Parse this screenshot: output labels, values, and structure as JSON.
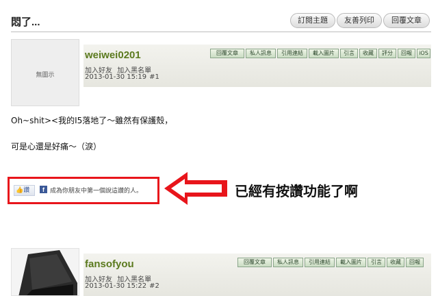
{
  "page": {
    "title": "悶了..."
  },
  "toolbar": {
    "subscribe": "訂閱主題",
    "print": "友善列印",
    "reply": "回覆文章"
  },
  "action_buttons": {
    "reply_post": "回覆文章",
    "private_msg": "私人訊息",
    "quote_link": "引用連結",
    "load_image": "載入圖片",
    "quote": "引言",
    "collect": "收藏",
    "rate": "評分",
    "report": "回報",
    "ios": "iOS"
  },
  "posts": [
    {
      "avatar_text": "無圖示",
      "username": "weiwei0201",
      "add_friend": "加入好友",
      "add_blacklist": "加入黑名單",
      "datetime": "2013-01-30 15:19",
      "number": "#1",
      "body": [
        "Oh~shit><我的I5落地了～雖然有保護殼，",
        "可是心還是好痛～（淚）"
      ]
    },
    {
      "username": "fansofyou",
      "add_friend": "加入好友",
      "add_blacklist": "加入黑名單",
      "datetime": "2013-01-30 15:22",
      "number": "#2"
    }
  ],
  "like": {
    "button_label": "讚",
    "fb_letter": "f",
    "text": "成為你朋友中第一個說這讚的人。"
  },
  "annotation": {
    "text": "已經有按讚功能了啊"
  },
  "colors": {
    "username": "#5b7a1e",
    "highlight": "#e8151b",
    "facebook": "#3b5998"
  }
}
